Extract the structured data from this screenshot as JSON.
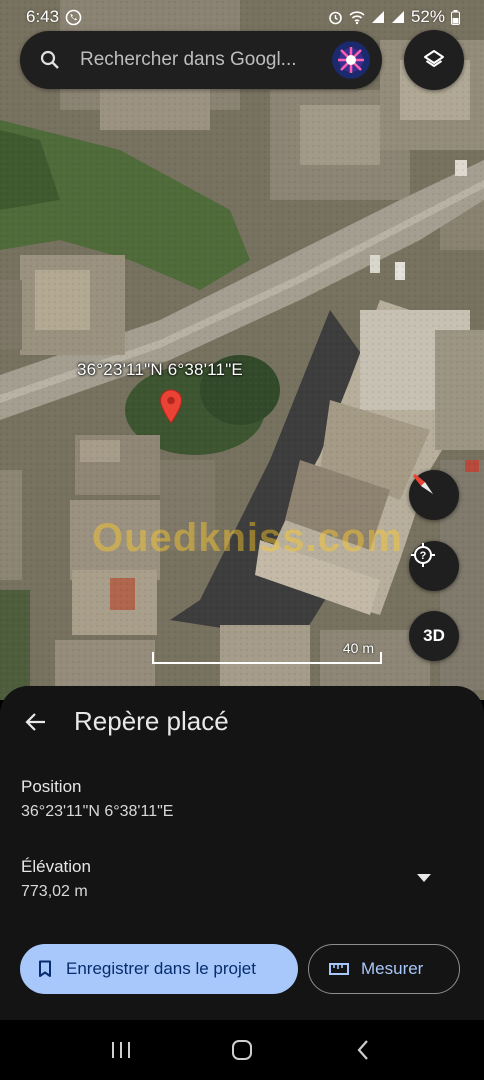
{
  "status_bar": {
    "time": "6:43",
    "battery": "52%",
    "icons": [
      "whatsapp-icon",
      "alarm-icon",
      "wifi-icon",
      "signal-icon",
      "signal-icon",
      "battery-icon"
    ]
  },
  "search": {
    "placeholder": "Rechercher dans Googl...",
    "icon": "search-icon",
    "layers_icon": "layers-icon"
  },
  "map": {
    "pin_coordinates": "36°23'11\"N 6°38'11\"E",
    "watermark": "Ouedkniss.com",
    "scale_label": "40 m",
    "buttons": {
      "compass_icon": "compass-icon",
      "locate_icon": "my-location-icon",
      "view_3d": "3D"
    }
  },
  "sheet": {
    "title": "Repère placé",
    "position_label": "Position",
    "position_value": "36°23'11\"N 6°38'11\"E",
    "elevation_label": "Élévation",
    "elevation_value": "773,02 m",
    "save_button": "Enregistrer dans le projet",
    "measure_button": "Mesurer"
  },
  "colors": {
    "accent": "#a8c7fa",
    "pin": "#ea4335",
    "sheet_bg": "#141414"
  }
}
